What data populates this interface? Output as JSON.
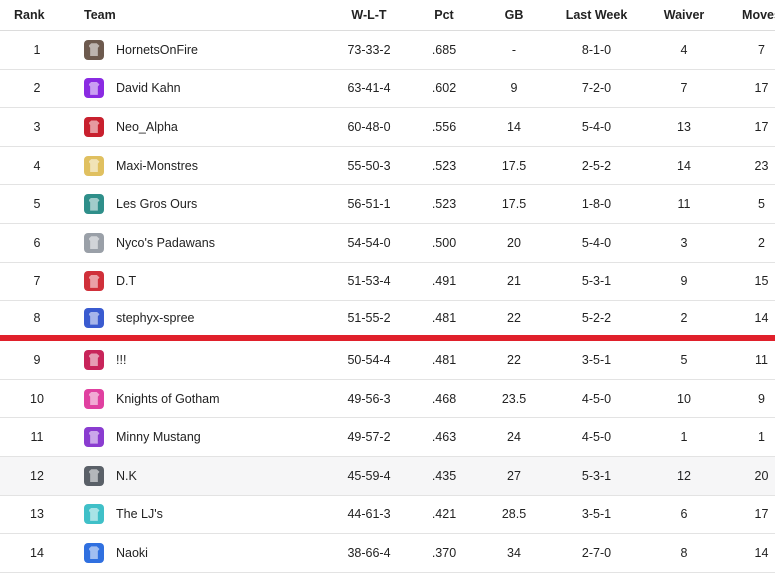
{
  "headers": {
    "rank": "Rank",
    "team": "Team",
    "wlt": "W-L-T",
    "pct": "Pct",
    "gb": "GB",
    "last_week": "Last Week",
    "waiver": "Waiver",
    "moves": "Moves"
  },
  "rows": [
    {
      "rank": "1",
      "team": "HornetsOnFire",
      "wlt": "73-33-2",
      "pct": ".685",
      "gb": "-",
      "last_week": "8-1-0",
      "waiver": "4",
      "moves": "7",
      "logo_color": "#6d5a4e",
      "logo_icon": "hornet-logo-icon"
    },
    {
      "rank": "2",
      "team": "David Kahn",
      "wlt": "63-41-4",
      "pct": ".602",
      "gb": "9",
      "last_week": "7-2-0",
      "waiver": "7",
      "moves": "17",
      "logo_color": "#8a2be2",
      "logo_icon": "purple-jersey-icon"
    },
    {
      "rank": "3",
      "team": "Neo_Alpha",
      "wlt": "60-48-0",
      "pct": ".556",
      "gb": "14",
      "last_week": "5-4-0",
      "waiver": "13",
      "moves": "17",
      "logo_color": "#c8202e",
      "logo_icon": "red-ball-logo-icon"
    },
    {
      "rank": "4",
      "team": "Maxi-Monstres",
      "wlt": "55-50-3",
      "pct": ".523",
      "gb": "17.5",
      "last_week": "2-5-2",
      "waiver": "14",
      "moves": "23",
      "logo_color": "#e0c060",
      "logo_icon": "monster-logo-icon"
    },
    {
      "rank": "5",
      "team": "Les Gros Ours",
      "wlt": "56-51-1",
      "pct": ".523",
      "gb": "17.5",
      "last_week": "1-8-0",
      "waiver": "11",
      "moves": "5",
      "logo_color": "#2f8f8a",
      "logo_icon": "grizzly-logo-icon"
    },
    {
      "rank": "6",
      "team": "Nyco's Padawans",
      "wlt": "54-54-0",
      "pct": ".500",
      "gb": "20",
      "last_week": "5-4-0",
      "waiver": "3",
      "moves": "2",
      "logo_color": "#9aa0a8",
      "logo_icon": "padawan-logo-icon"
    },
    {
      "rank": "7",
      "team": "D.T",
      "wlt": "51-53-4",
      "pct": ".491",
      "gb": "21",
      "last_week": "5-3-1",
      "waiver": "9",
      "moves": "15",
      "logo_color": "#d0303a",
      "logo_icon": "red-badge-logo-icon"
    },
    {
      "rank": "8",
      "team": "stephyx-spree",
      "wlt": "51-55-2",
      "pct": ".481",
      "gb": "22",
      "last_week": "5-2-2",
      "waiver": "2",
      "moves": "14",
      "logo_color": "#3a5bd0",
      "logo_icon": "blue-red-jersey-icon"
    },
    {
      "rank": "9",
      "team": "!!!",
      "wlt": "50-54-4",
      "pct": ".481",
      "gb": "22",
      "last_week": "3-5-1",
      "waiver": "5",
      "moves": "11",
      "logo_color": "#c8245a",
      "logo_icon": "magenta-jersey-icon"
    },
    {
      "rank": "10",
      "team": "Knights of Gotham",
      "wlt": "49-56-3",
      "pct": ".468",
      "gb": "23.5",
      "last_week": "4-5-0",
      "waiver": "10",
      "moves": "9",
      "logo_color": "#e040a0",
      "logo_icon": "pink-green-jersey-icon"
    },
    {
      "rank": "11",
      "team": "Minny Mustang",
      "wlt": "49-57-2",
      "pct": ".463",
      "gb": "24",
      "last_week": "4-5-0",
      "waiver": "1",
      "moves": "1",
      "logo_color": "#8a3cd0",
      "logo_icon": "purple-gold-jersey-icon"
    },
    {
      "rank": "12",
      "team": "N.K",
      "wlt": "45-59-4",
      "pct": ".435",
      "gb": "27",
      "last_week": "5-3-1",
      "waiver": "12",
      "moves": "20",
      "logo_color": "#5a6068",
      "logo_icon": "gray-badge-logo-icon"
    },
    {
      "rank": "13",
      "team": "The LJ's",
      "wlt": "44-61-3",
      "pct": ".421",
      "gb": "28.5",
      "last_week": "3-5-1",
      "waiver": "6",
      "moves": "17",
      "logo_color": "#40c0c8",
      "logo_icon": "cyan-pink-jersey-icon"
    },
    {
      "rank": "14",
      "team": "Naoki",
      "wlt": "38-66-4",
      "pct": ".370",
      "gb": "34",
      "last_week": "2-7-0",
      "waiver": "8",
      "moves": "14",
      "logo_color": "#3070e0",
      "logo_icon": "blue-orange-jersey-icon"
    }
  ],
  "playoff_line_color": "#e0202b"
}
